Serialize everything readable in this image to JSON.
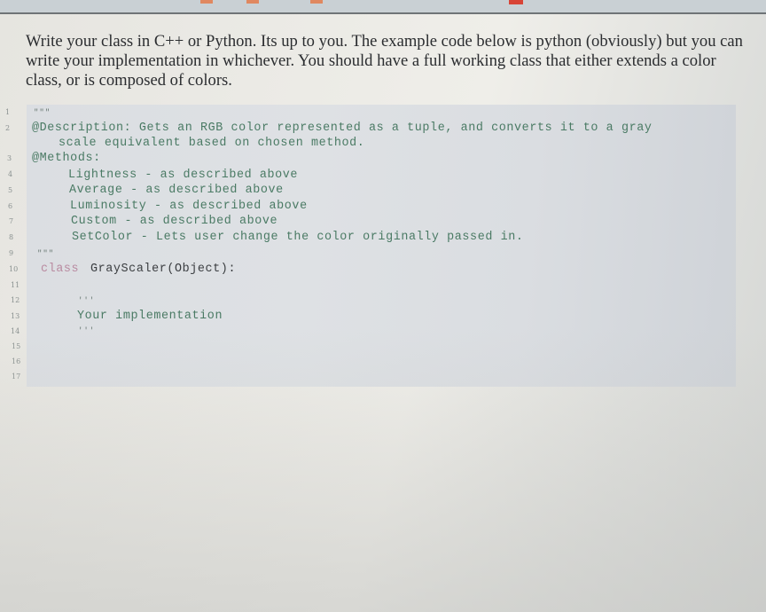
{
  "browser": {
    "tabs": [
      {
        "label": "",
        "favicon": "orange-tab-icon"
      },
      {
        "label": "",
        "favicon": "orange-tab-icon"
      },
      {
        "label": "",
        "favicon": "orange-tab-icon"
      },
      {
        "label": "",
        "favicon": "red-tab-icon"
      }
    ]
  },
  "instructions": {
    "text": "Write your class in C++ or Python. Its up to you. The example code below is python (obviously) but you can write your implementation in whichever. You should have a full working class that either extends a color class, or is composed of colors."
  },
  "code": {
    "language": "python",
    "lines": [
      {
        "num": "1",
        "text": "\"\"\""
      },
      {
        "num": "2",
        "text": "@Description: Gets an RGB color represented as a tuple, and converts it to a gray"
      },
      {
        "num": "",
        "text": "scale equivalent based on chosen method."
      },
      {
        "num": "3",
        "text": "@Methods:"
      },
      {
        "num": "4",
        "text": "Lightness - as described above"
      },
      {
        "num": "5",
        "text": "Average - as described above"
      },
      {
        "num": "6",
        "text": "Luminosity - as described above"
      },
      {
        "num": "7",
        "text": "Custom - as described above"
      },
      {
        "num": "8",
        "text": "SetColor - Lets user change the color originally passed in."
      },
      {
        "num": "9",
        "text": "\"\"\""
      },
      {
        "num": "10",
        "keyword": "class",
        "text": "GrayScaler(Object):"
      },
      {
        "num": "11",
        "text": ""
      },
      {
        "num": "12",
        "text": "'''"
      },
      {
        "num": "13",
        "text": "Your implementation"
      },
      {
        "num": "14",
        "text": "'''"
      },
      {
        "num": "15",
        "text": ""
      },
      {
        "num": "16",
        "text": ""
      },
      {
        "num": "17",
        "text": ""
      }
    ]
  }
}
